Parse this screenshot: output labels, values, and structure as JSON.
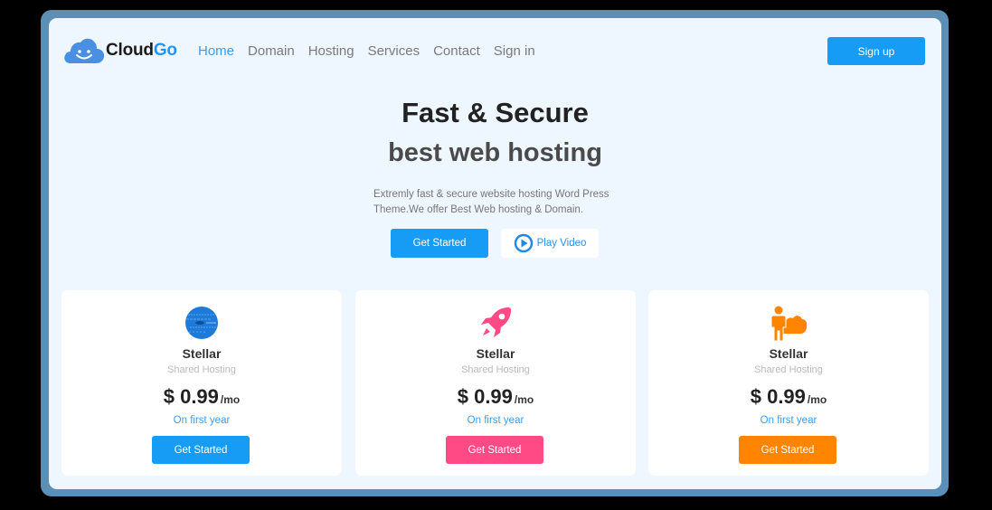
{
  "brand": {
    "name_part1": "Cloud",
    "name_part2": "Go",
    "logo_icon": "smiling-cloud-icon",
    "accent": "#2196f3"
  },
  "nav": {
    "items": [
      {
        "label": "Home",
        "active": true
      },
      {
        "label": "Domain",
        "active": false
      },
      {
        "label": "Hosting",
        "active": false
      },
      {
        "label": "Services",
        "active": false
      },
      {
        "label": "Contact",
        "active": false
      },
      {
        "label": "Sign in",
        "active": false
      }
    ],
    "signup_label": "Sign up"
  },
  "hero": {
    "title": "Fast & Secure",
    "subtitle": "best web hosting",
    "description": "Extremly fast & secure website hosting Word Press Theme.We offer Best Web hosting & Domain.",
    "primary_button": "Get Started",
    "video_button": "Play Video",
    "video_icon": "play-circle-icon"
  },
  "plans": [
    {
      "icon": "globe-icon",
      "name": "Stellar",
      "type": "Shared Hosting",
      "price": "$ 0.99",
      "unit": "/mo",
      "term": "On first year",
      "button": "Get Started",
      "color": "#179cf5"
    },
    {
      "icon": "rocket-icon",
      "name": "Stellar",
      "type": "Shared Hosting",
      "price": "$ 0.99",
      "unit": "/mo",
      "term": "On first year",
      "button": "Get Started",
      "color": "#ff4a86"
    },
    {
      "icon": "person-cloud-icon",
      "name": "Stellar",
      "type": "Shared Hosting",
      "price": "$ 0.99",
      "unit": "/mo",
      "term": "On first year",
      "button": "Get Started",
      "color": "#ff8400"
    }
  ]
}
